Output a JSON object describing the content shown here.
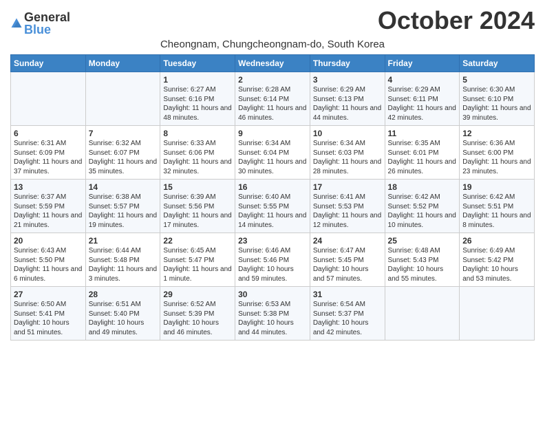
{
  "header": {
    "logo_general": "General",
    "logo_blue": "Blue",
    "month_year": "October 2024",
    "location": "Cheongnam, Chungcheongnam-do, South Korea"
  },
  "weekdays": [
    "Sunday",
    "Monday",
    "Tuesday",
    "Wednesday",
    "Thursday",
    "Friday",
    "Saturday"
  ],
  "weeks": [
    [
      {
        "day": "",
        "sunrise": "",
        "sunset": "",
        "daylight": ""
      },
      {
        "day": "",
        "sunrise": "",
        "sunset": "",
        "daylight": ""
      },
      {
        "day": "1",
        "sunrise": "Sunrise: 6:27 AM",
        "sunset": "Sunset: 6:16 PM",
        "daylight": "Daylight: 11 hours and 48 minutes."
      },
      {
        "day": "2",
        "sunrise": "Sunrise: 6:28 AM",
        "sunset": "Sunset: 6:14 PM",
        "daylight": "Daylight: 11 hours and 46 minutes."
      },
      {
        "day": "3",
        "sunrise": "Sunrise: 6:29 AM",
        "sunset": "Sunset: 6:13 PM",
        "daylight": "Daylight: 11 hours and 44 minutes."
      },
      {
        "day": "4",
        "sunrise": "Sunrise: 6:29 AM",
        "sunset": "Sunset: 6:11 PM",
        "daylight": "Daylight: 11 hours and 42 minutes."
      },
      {
        "day": "5",
        "sunrise": "Sunrise: 6:30 AM",
        "sunset": "Sunset: 6:10 PM",
        "daylight": "Daylight: 11 hours and 39 minutes."
      }
    ],
    [
      {
        "day": "6",
        "sunrise": "Sunrise: 6:31 AM",
        "sunset": "Sunset: 6:09 PM",
        "daylight": "Daylight: 11 hours and 37 minutes."
      },
      {
        "day": "7",
        "sunrise": "Sunrise: 6:32 AM",
        "sunset": "Sunset: 6:07 PM",
        "daylight": "Daylight: 11 hours and 35 minutes."
      },
      {
        "day": "8",
        "sunrise": "Sunrise: 6:33 AM",
        "sunset": "Sunset: 6:06 PM",
        "daylight": "Daylight: 11 hours and 32 minutes."
      },
      {
        "day": "9",
        "sunrise": "Sunrise: 6:34 AM",
        "sunset": "Sunset: 6:04 PM",
        "daylight": "Daylight: 11 hours and 30 minutes."
      },
      {
        "day": "10",
        "sunrise": "Sunrise: 6:34 AM",
        "sunset": "Sunset: 6:03 PM",
        "daylight": "Daylight: 11 hours and 28 minutes."
      },
      {
        "day": "11",
        "sunrise": "Sunrise: 6:35 AM",
        "sunset": "Sunset: 6:01 PM",
        "daylight": "Daylight: 11 hours and 26 minutes."
      },
      {
        "day": "12",
        "sunrise": "Sunrise: 6:36 AM",
        "sunset": "Sunset: 6:00 PM",
        "daylight": "Daylight: 11 hours and 23 minutes."
      }
    ],
    [
      {
        "day": "13",
        "sunrise": "Sunrise: 6:37 AM",
        "sunset": "Sunset: 5:59 PM",
        "daylight": "Daylight: 11 hours and 21 minutes."
      },
      {
        "day": "14",
        "sunrise": "Sunrise: 6:38 AM",
        "sunset": "Sunset: 5:57 PM",
        "daylight": "Daylight: 11 hours and 19 minutes."
      },
      {
        "day": "15",
        "sunrise": "Sunrise: 6:39 AM",
        "sunset": "Sunset: 5:56 PM",
        "daylight": "Daylight: 11 hours and 17 minutes."
      },
      {
        "day": "16",
        "sunrise": "Sunrise: 6:40 AM",
        "sunset": "Sunset: 5:55 PM",
        "daylight": "Daylight: 11 hours and 14 minutes."
      },
      {
        "day": "17",
        "sunrise": "Sunrise: 6:41 AM",
        "sunset": "Sunset: 5:53 PM",
        "daylight": "Daylight: 11 hours and 12 minutes."
      },
      {
        "day": "18",
        "sunrise": "Sunrise: 6:42 AM",
        "sunset": "Sunset: 5:52 PM",
        "daylight": "Daylight: 11 hours and 10 minutes."
      },
      {
        "day": "19",
        "sunrise": "Sunrise: 6:42 AM",
        "sunset": "Sunset: 5:51 PM",
        "daylight": "Daylight: 11 hours and 8 minutes."
      }
    ],
    [
      {
        "day": "20",
        "sunrise": "Sunrise: 6:43 AM",
        "sunset": "Sunset: 5:50 PM",
        "daylight": "Daylight: 11 hours and 6 minutes."
      },
      {
        "day": "21",
        "sunrise": "Sunrise: 6:44 AM",
        "sunset": "Sunset: 5:48 PM",
        "daylight": "Daylight: 11 hours and 3 minutes."
      },
      {
        "day": "22",
        "sunrise": "Sunrise: 6:45 AM",
        "sunset": "Sunset: 5:47 PM",
        "daylight": "Daylight: 11 hours and 1 minute."
      },
      {
        "day": "23",
        "sunrise": "Sunrise: 6:46 AM",
        "sunset": "Sunset: 5:46 PM",
        "daylight": "Daylight: 10 hours and 59 minutes."
      },
      {
        "day": "24",
        "sunrise": "Sunrise: 6:47 AM",
        "sunset": "Sunset: 5:45 PM",
        "daylight": "Daylight: 10 hours and 57 minutes."
      },
      {
        "day": "25",
        "sunrise": "Sunrise: 6:48 AM",
        "sunset": "Sunset: 5:43 PM",
        "daylight": "Daylight: 10 hours and 55 minutes."
      },
      {
        "day": "26",
        "sunrise": "Sunrise: 6:49 AM",
        "sunset": "Sunset: 5:42 PM",
        "daylight": "Daylight: 10 hours and 53 minutes."
      }
    ],
    [
      {
        "day": "27",
        "sunrise": "Sunrise: 6:50 AM",
        "sunset": "Sunset: 5:41 PM",
        "daylight": "Daylight: 10 hours and 51 minutes."
      },
      {
        "day": "28",
        "sunrise": "Sunrise: 6:51 AM",
        "sunset": "Sunset: 5:40 PM",
        "daylight": "Daylight: 10 hours and 49 minutes."
      },
      {
        "day": "29",
        "sunrise": "Sunrise: 6:52 AM",
        "sunset": "Sunset: 5:39 PM",
        "daylight": "Daylight: 10 hours and 46 minutes."
      },
      {
        "day": "30",
        "sunrise": "Sunrise: 6:53 AM",
        "sunset": "Sunset: 5:38 PM",
        "daylight": "Daylight: 10 hours and 44 minutes."
      },
      {
        "day": "31",
        "sunrise": "Sunrise: 6:54 AM",
        "sunset": "Sunset: 5:37 PM",
        "daylight": "Daylight: 10 hours and 42 minutes."
      },
      {
        "day": "",
        "sunrise": "",
        "sunset": "",
        "daylight": ""
      },
      {
        "day": "",
        "sunrise": "",
        "sunset": "",
        "daylight": ""
      }
    ]
  ]
}
